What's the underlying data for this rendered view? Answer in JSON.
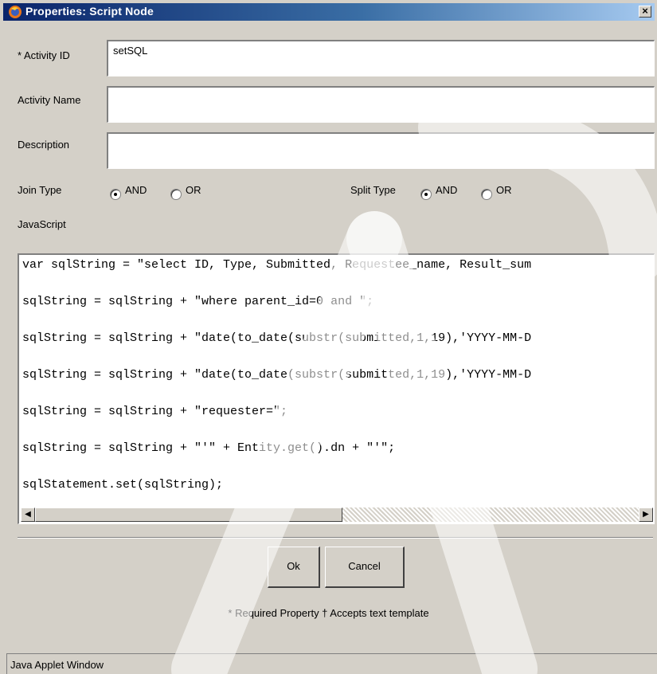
{
  "window": {
    "title": "Properties: Script Node",
    "close_glyph": "×"
  },
  "form": {
    "activity_id_label": "* Activity ID",
    "activity_id_value": "setSQL",
    "activity_name_label": "Activity Name",
    "activity_name_value": "",
    "description_label": "Description",
    "description_value": "",
    "join_type_label": "Join Type",
    "join_options": [
      "AND",
      "OR"
    ],
    "join_selected": "AND",
    "split_type_label": "Split Type",
    "split_options": [
      "AND",
      "OR"
    ],
    "split_selected": "AND",
    "javascript_label": "JavaScript"
  },
  "code_lines": [
    "var sqlString = \"select ID, Type, Submitted, Requestee_name, Result_sum",
    "sqlString = sqlString + \"where parent_id=0 and \";",
    "sqlString = sqlString + \"date(to_date(substr(submitted,1,19),'YYYY-MM-D",
    "sqlString = sqlString + \"date(to_date(substr(submitted,1,19),'YYYY-MM-D",
    "sqlString = sqlString + \"requester=\";",
    "sqlString = sqlString + \"'\" + Entity.get().dn + \"'\";",
    "sqlStatement.set(sqlString);"
  ],
  "buttons": {
    "ok": "Ok",
    "cancel": "Cancel"
  },
  "footnote": "* Required Property  † Accepts text template",
  "status": "Java Applet Window",
  "colors": {
    "title_bar_start": "#0a246a",
    "title_bar_end": "#a6caf0",
    "dialog_bg": "#d4d0c8"
  }
}
